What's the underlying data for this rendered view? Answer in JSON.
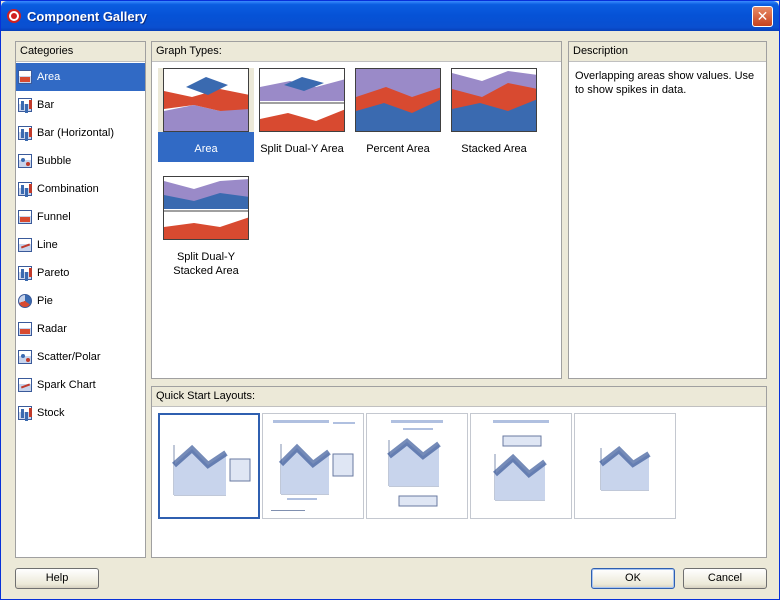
{
  "window": {
    "title": "Component Gallery",
    "close_label": "✕"
  },
  "categories": {
    "header": "Categories",
    "items": [
      {
        "label": "Area",
        "icon": "area-chart-icon"
      },
      {
        "label": "Bar",
        "icon": "bar-chart-icon"
      },
      {
        "label": "Bar (Horizontal)",
        "icon": "horizontal-bar-chart-icon"
      },
      {
        "label": "Bubble",
        "icon": "bubble-chart-icon"
      },
      {
        "label": "Combination",
        "icon": "combination-chart-icon"
      },
      {
        "label": "Funnel",
        "icon": "funnel-chart-icon"
      },
      {
        "label": "Line",
        "icon": "line-chart-icon"
      },
      {
        "label": "Pareto",
        "icon": "pareto-chart-icon"
      },
      {
        "label": "Pie",
        "icon": "pie-chart-icon"
      },
      {
        "label": "Radar",
        "icon": "radar-chart-icon"
      },
      {
        "label": "Scatter/Polar",
        "icon": "scatter-chart-icon"
      },
      {
        "label": "Spark Chart",
        "icon": "spark-chart-icon"
      },
      {
        "label": "Stock",
        "icon": "stock-chart-icon"
      }
    ],
    "selected": "Area"
  },
  "graph_types": {
    "header": "Graph Types:",
    "items": [
      {
        "label": "Area"
      },
      {
        "label": "Split Dual-Y Area"
      },
      {
        "label": "Percent Area"
      },
      {
        "label": "Stacked Area"
      },
      {
        "label": "Split Dual-Y Stacked Area"
      }
    ],
    "selected": "Area"
  },
  "description": {
    "header": "Description",
    "text": "Overlapping areas show values. Use to show spikes in data."
  },
  "quick_start": {
    "header": "Quick Start Layouts:"
  },
  "buttons": {
    "help": "Help",
    "ok": "OK",
    "cancel": "Cancel"
  },
  "colors": {
    "selection": "#316ac5",
    "title_bar": "#0a5de0",
    "area_red": "#d84a30",
    "area_blue": "#3a6ab0",
    "area_purple": "#9a8ac8"
  }
}
